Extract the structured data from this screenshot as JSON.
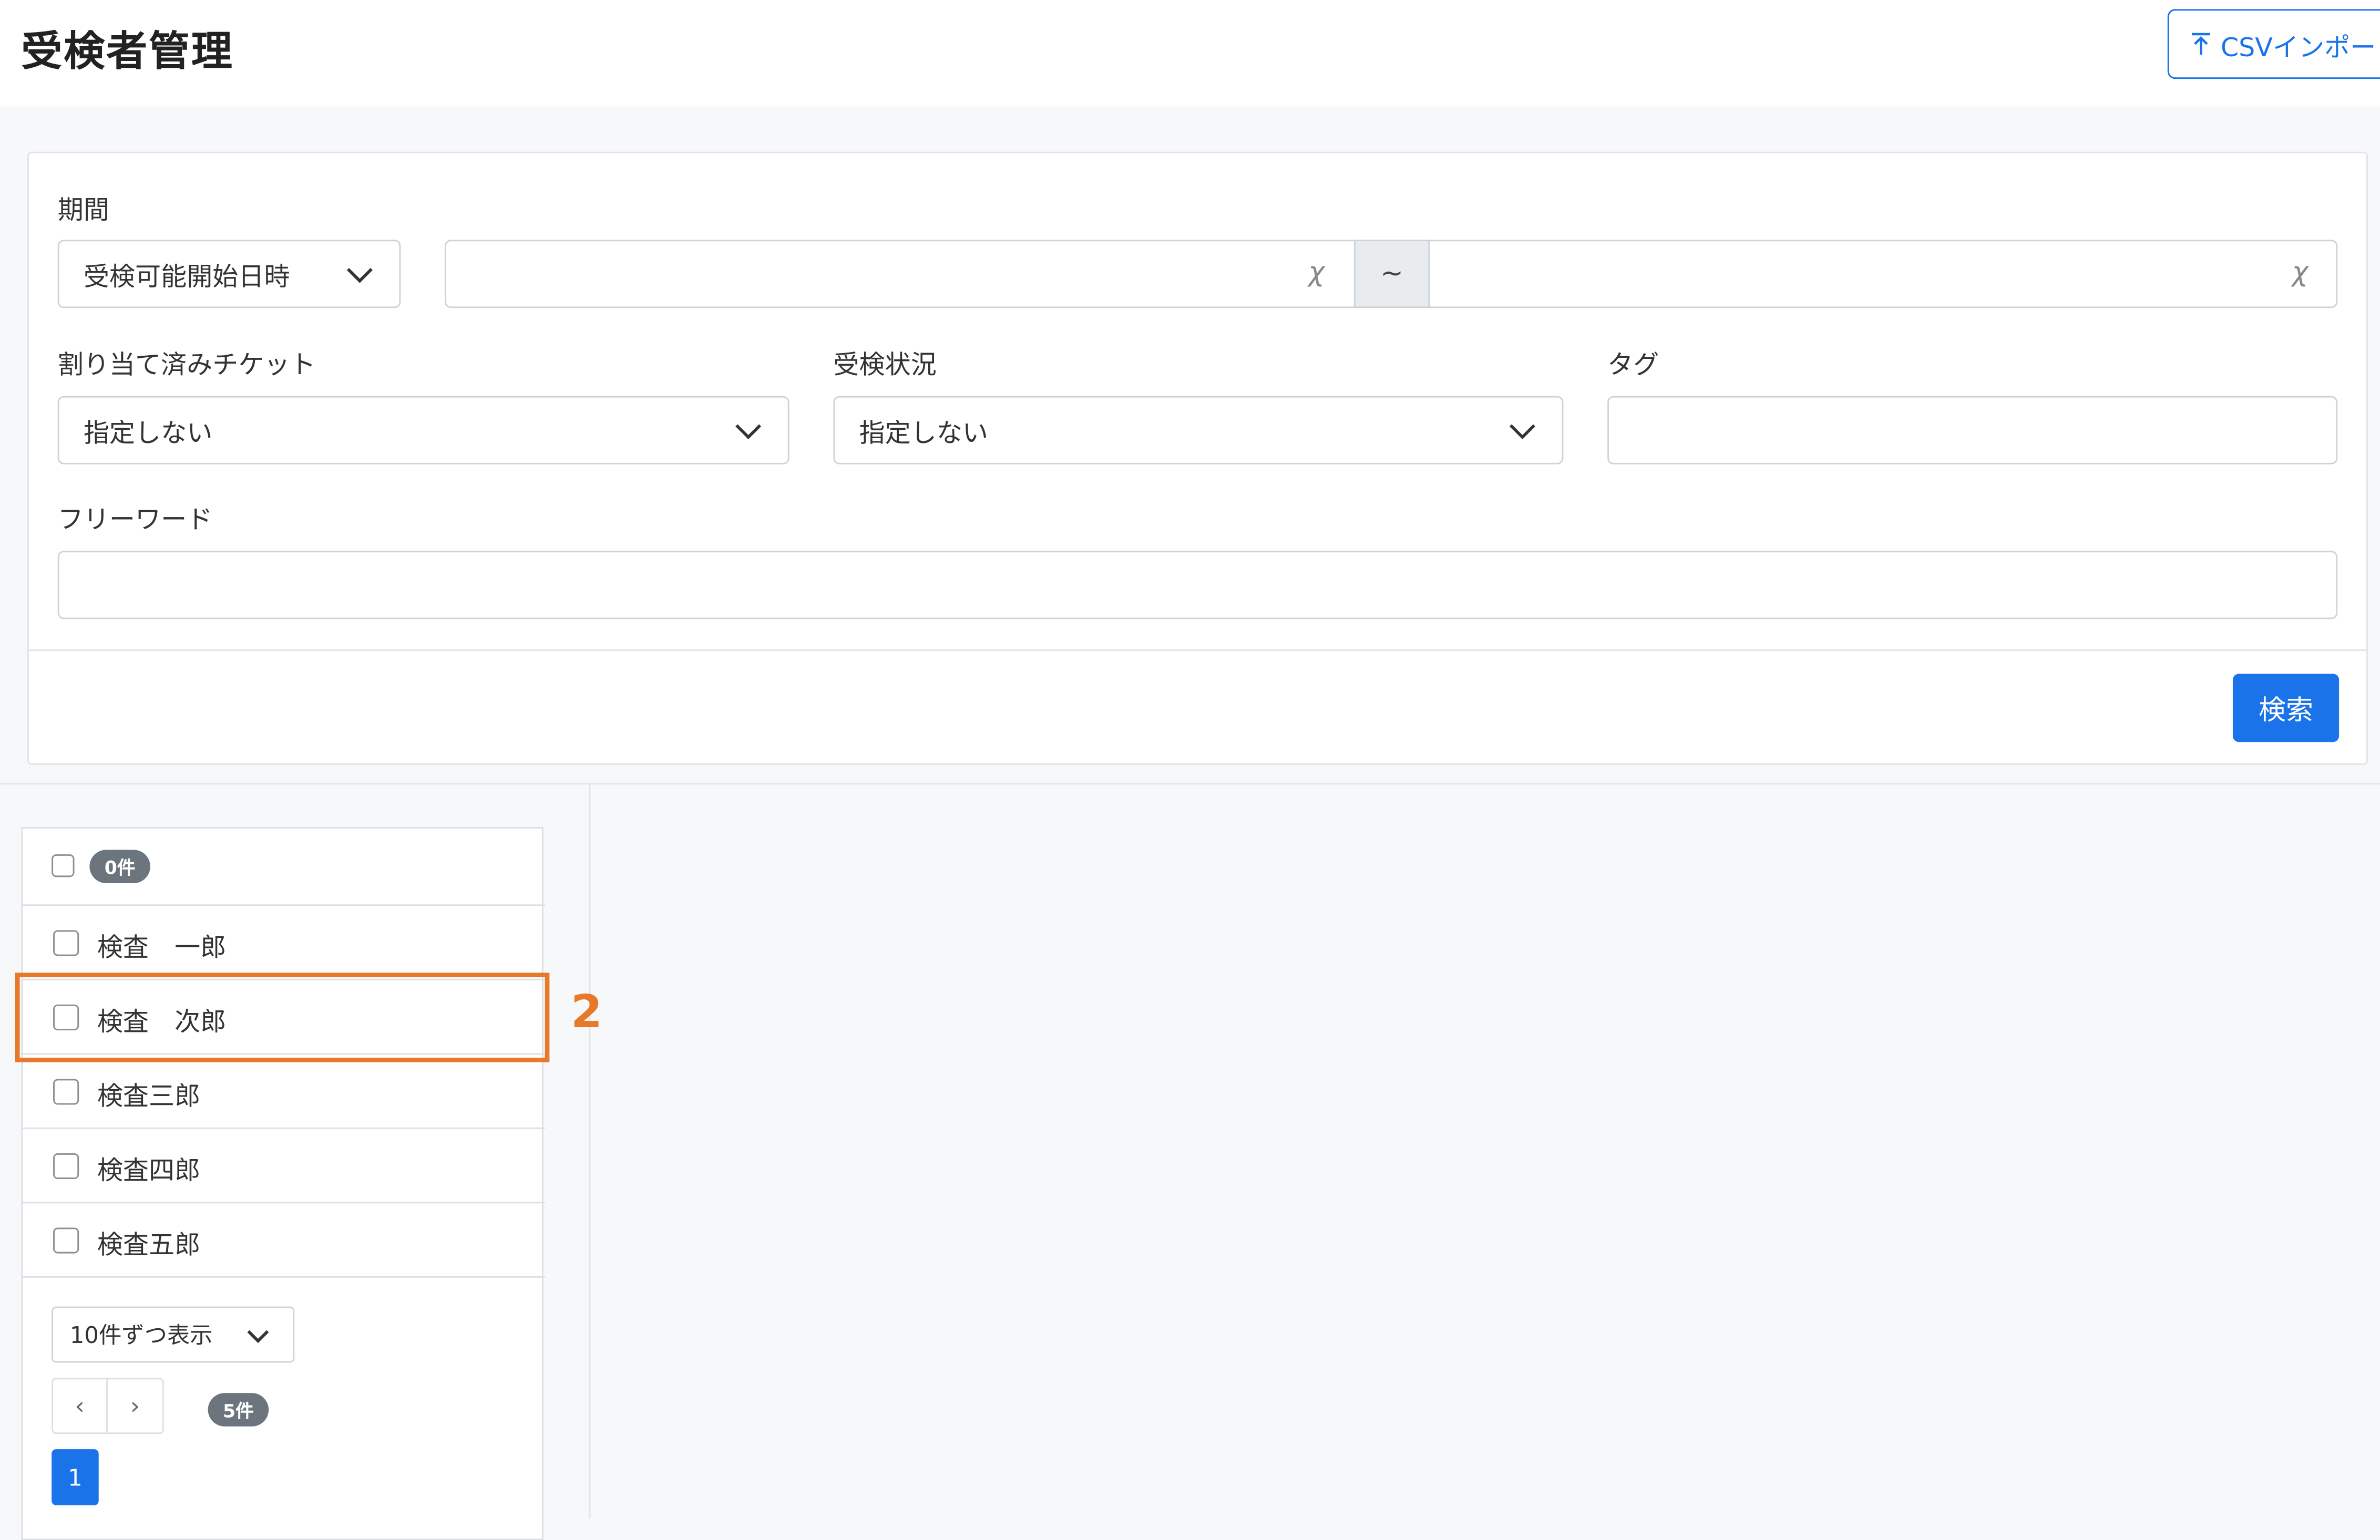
{
  "header": {
    "title": "受検者管理",
    "csv_import_label": "CSVインポート",
    "csv_icon": "upload-arrow-icon"
  },
  "filters": {
    "period_label": "期間",
    "period_select_value": "受検可能開始日時",
    "date_from_value": "",
    "date_to_value": "",
    "clear_symbol": "χ",
    "range_separator": "~",
    "ticket_label": "割り当て済みチケット",
    "ticket_value": "指定しない",
    "status_label": "受検状況",
    "status_value": "指定しない",
    "tag_label": "タグ",
    "tag_value": "",
    "freeword_label": "フリーワード",
    "freeword_value": "",
    "search_button": "検索"
  },
  "list": {
    "selected_count": "0件",
    "examinees": [
      {
        "name": "検査　一郎"
      },
      {
        "name": "検査　次郎"
      },
      {
        "name": "検査三郎"
      },
      {
        "name": "検査四郎"
      },
      {
        "name": "検査五郎"
      }
    ],
    "per_page_value": "10件ずつ表示",
    "prev_symbol": "‹",
    "next_symbol": "›",
    "total_count": "5件",
    "current_page": "1"
  },
  "annotation": {
    "label": "2",
    "color": "#e8782a"
  },
  "colors": {
    "accent": "#1a73e8",
    "badge": "#6c757d",
    "highlight": "#e8782a"
  }
}
